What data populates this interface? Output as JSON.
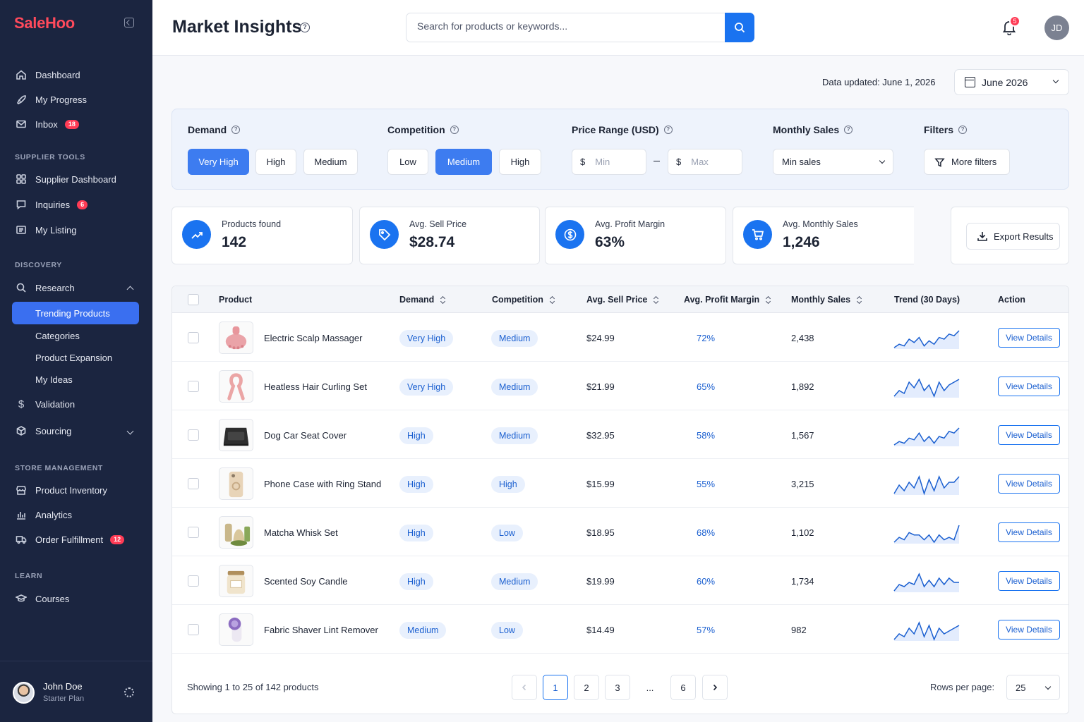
{
  "sidebar": {
    "logo": "SaleHoo",
    "items_top": [
      {
        "label": "Dashboard",
        "icon": "home-icon"
      },
      {
        "label": "My Progress",
        "icon": "rocket-icon"
      },
      {
        "label": "Inbox",
        "icon": "mail-icon",
        "badge": "18"
      }
    ],
    "sections": {
      "supplier_tools": "SUPPLIER TOOLS",
      "discovery": "DISCOVERY",
      "store_management": "STORE MANAGEMENT",
      "learn": "LEARN"
    },
    "supplier_items": [
      {
        "label": "Supplier Dashboard",
        "icon": "grid-icon"
      },
      {
        "label": "Inquiries",
        "icon": "chat-icon",
        "badge": "6"
      },
      {
        "label": "My Listing",
        "icon": "list-icon"
      }
    ],
    "discovery_items": {
      "research": "Research",
      "sub": [
        "Trending Products",
        "Categories",
        "Product Expansion",
        "My Ideas"
      ],
      "validation": "Validation",
      "sourcing": "Sourcing"
    },
    "store_items": [
      {
        "label": "Product Inventory",
        "icon": "store-icon"
      },
      {
        "label": "Analytics",
        "icon": "bar-chart-icon"
      },
      {
        "label": "Order Fulfillment",
        "icon": "truck-icon",
        "badge": "12"
      }
    ],
    "learn_items": [
      {
        "label": "Courses",
        "icon": "graduation-cap-icon"
      }
    ],
    "user": {
      "name": "John Doe",
      "plan": "Starter Plan"
    }
  },
  "header": {
    "title": "Market Insights",
    "search_placeholder": "Search for products or keywords...",
    "notification_count": "5",
    "avatar_initials": "JD"
  },
  "meta": {
    "updated": "Data updated: June 1, 2026",
    "month": "June 2026"
  },
  "filters": {
    "demand": {
      "label": "Demand",
      "options": [
        "Very High",
        "High",
        "Medium"
      ],
      "selected": "Very High"
    },
    "competition": {
      "label": "Competition",
      "options": [
        "Low",
        "Medium",
        "High"
      ],
      "selected": "Medium"
    },
    "price": {
      "label": "Price Range (USD)",
      "currency": "$",
      "min_placeholder": "Min",
      "max_placeholder": "Max"
    },
    "monthly_sales": {
      "label": "Monthly Sales",
      "value": "Min sales"
    },
    "more": {
      "label": "Filters",
      "button": "More filters"
    }
  },
  "stats": [
    {
      "label": "Products found",
      "value": "142",
      "icon": "trend-up-icon"
    },
    {
      "label": "Avg. Sell Price",
      "value": "$28.74",
      "icon": "tag-icon"
    },
    {
      "label": "Avg. Profit Margin",
      "value": "63%",
      "icon": "dollar-icon"
    },
    {
      "label": "Avg. Monthly Sales",
      "value": "1,246",
      "icon": "cart-icon"
    }
  ],
  "export_label": "Export Results",
  "table": {
    "columns": [
      "Product",
      "Demand",
      "Competition",
      "Avg. Sell Price",
      "Avg. Profit Margin",
      "Monthly Sales",
      "Trend (30 Days)",
      "Action"
    ],
    "action_label": "View Details",
    "rows": [
      {
        "name": "Electric Scalp Massager",
        "demand": "Very High",
        "competition": "Medium",
        "price": "$24.99",
        "margin": "72%",
        "sales": "2,438",
        "trend": [
          3,
          5,
          4,
          8,
          6,
          9,
          4,
          7,
          5,
          9,
          8,
          11,
          10,
          13
        ],
        "thumb": "pink-massager"
      },
      {
        "name": "Heatless Hair Curling Set",
        "demand": "Very High",
        "competition": "Medium",
        "price": "$21.99",
        "margin": "65%",
        "sales": "1,892",
        "trend": [
          4,
          6,
          5,
          9,
          7,
          10,
          6,
          8,
          4,
          9,
          6,
          8,
          9,
          10
        ],
        "thumb": "pink-ribbon"
      },
      {
        "name": "Dog Car Seat Cover",
        "demand": "High",
        "competition": "Medium",
        "price": "$32.95",
        "margin": "58%",
        "sales": "1,567",
        "trend": [
          3,
          5,
          4,
          7,
          6,
          10,
          5,
          8,
          4,
          8,
          7,
          11,
          10,
          13
        ],
        "thumb": "black-seat"
      },
      {
        "name": "Phone Case with Ring Stand",
        "demand": "High",
        "competition": "High",
        "price": "$15.99",
        "margin": "55%",
        "sales": "3,215",
        "trend": [
          4,
          7,
          5,
          8,
          6,
          10,
          4,
          9,
          5,
          10,
          6,
          8,
          8,
          10
        ],
        "thumb": "beige-phone"
      },
      {
        "name": "Matcha Whisk Set",
        "demand": "High",
        "competition": "Low",
        "price": "$18.95",
        "margin": "68%",
        "sales": "1,102",
        "trend": [
          4,
          6,
          5,
          8,
          7,
          7,
          5,
          7,
          4,
          7,
          5,
          6,
          5,
          11
        ],
        "thumb": "matcha"
      },
      {
        "name": "Scented Soy Candle",
        "demand": "High",
        "competition": "Medium",
        "price": "$19.99",
        "margin": "60%",
        "sales": "1,734",
        "trend": [
          3,
          6,
          5,
          7,
          6,
          11,
          5,
          8,
          5,
          9,
          6,
          9,
          7,
          7
        ],
        "thumb": "candle"
      },
      {
        "name": "Fabric Shaver Lint Remover",
        "demand": "Medium",
        "competition": "Low",
        "price": "$14.49",
        "margin": "57%",
        "sales": "982",
        "trend": [
          4,
          6,
          5,
          8,
          6,
          10,
          5,
          9,
          4,
          8,
          6,
          7,
          8,
          9
        ],
        "thumb": "lint-shaver"
      }
    ]
  },
  "pagination": {
    "showing": "Showing 1 to 25 of 142 products",
    "pages": [
      "1",
      "2",
      "3",
      "...",
      "6"
    ],
    "current": "1",
    "rows_label": "Rows per page:",
    "rows_value": "25"
  },
  "colors": {
    "accent": "#1a73f0",
    "sidebar": "#1b2540",
    "brand": "#ff4a5c",
    "badge": "#ff3b55"
  }
}
